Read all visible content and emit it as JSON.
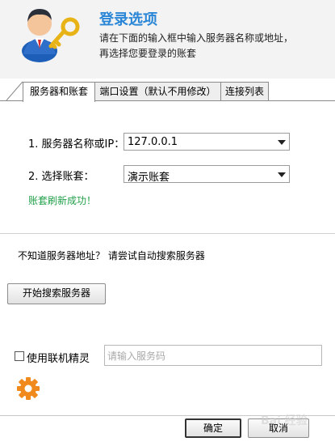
{
  "header": {
    "title": "登录选项",
    "subtitle_line1": "请在下面的输入框中输入服务器名称或地址，",
    "subtitle_line2": "再选择您要登录的账套"
  },
  "tabs": [
    {
      "label": "服务器和账套",
      "active": true
    },
    {
      "label": "端口设置（默认不用修改）",
      "active": false
    },
    {
      "label": "连接列表",
      "active": false
    }
  ],
  "form": {
    "server_label": "1. 服务器名称或IP：",
    "server_value": "127.0.0.1",
    "account_label": "2. 选择账套：",
    "account_value": "演示账套",
    "status_message": "账套刷新成功！"
  },
  "search": {
    "hint": "不知道服务器地址？ 请尝试自动搜索服务器",
    "button_label": "开始搜索服务器"
  },
  "wizard": {
    "checkbox_label": "使用联机精灵",
    "checked": false,
    "service_code_placeholder": "请输入服务码"
  },
  "footer": {
    "ok_label": "确定",
    "cancel_label": "取消",
    "watermark": "Bai 经验"
  },
  "colors": {
    "title": "#2a86d6",
    "success": "#22a04a",
    "gear": "#f08a1c"
  },
  "icons": {
    "avatar": "user-key-icon",
    "settings": "gear-icon",
    "dropdown": "chevron-down-icon"
  }
}
